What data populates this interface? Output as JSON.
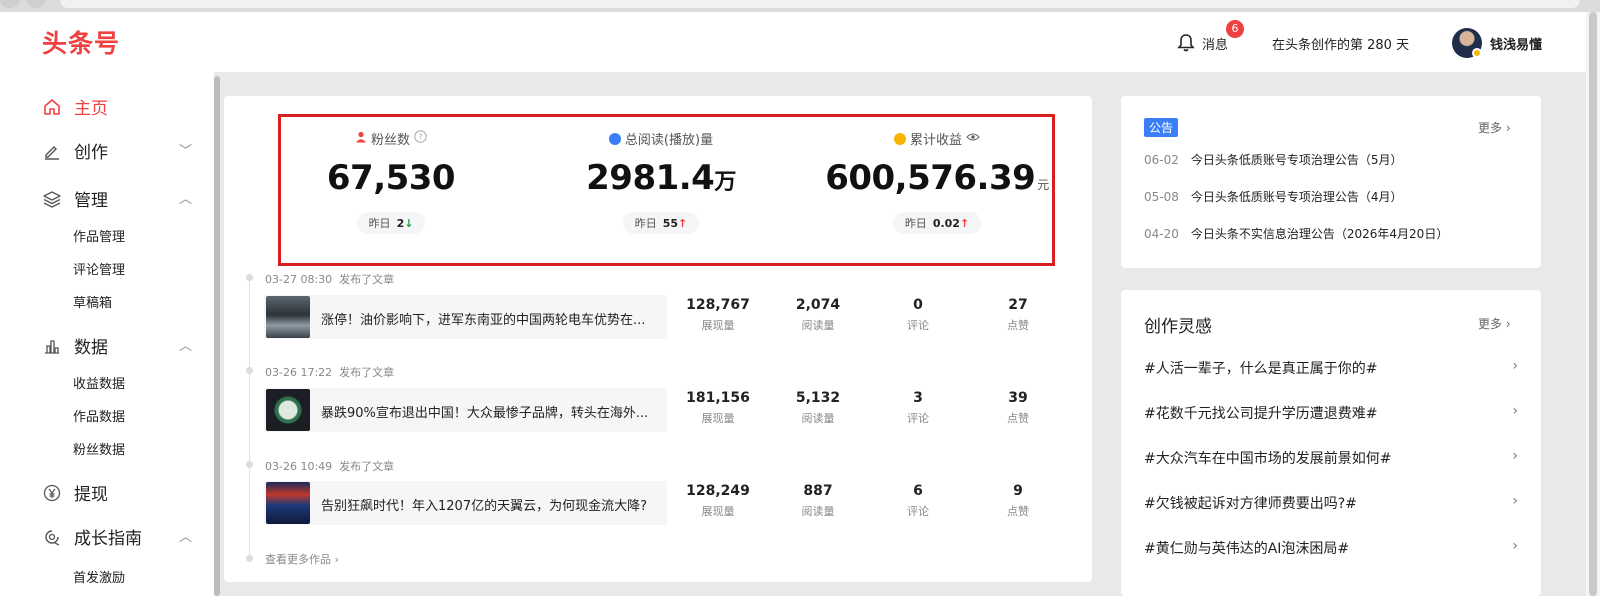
{
  "header": {
    "logo": "头条号",
    "messages_label": "消息",
    "messages_badge": "6",
    "days_text": "在头条创作的第 280 天",
    "username": "钱浅易懂"
  },
  "sidebar": {
    "items": [
      {
        "label": "主页",
        "icon": "home-icon",
        "active": true
      },
      {
        "label": "创作",
        "icon": "pen-icon",
        "chevron": "down"
      },
      {
        "label": "管理",
        "icon": "layers-icon",
        "chevron": "up"
      },
      {
        "label": "作品管理"
      },
      {
        "label": "评论管理"
      },
      {
        "label": "草稿箱"
      },
      {
        "label": "数据",
        "icon": "bar-chart-icon",
        "chevron": "up"
      },
      {
        "label": "收益数据"
      },
      {
        "label": "作品数据"
      },
      {
        "label": "粉丝数据"
      },
      {
        "label": "提现",
        "icon": "yen-icon"
      },
      {
        "label": "成长指南",
        "icon": "growth-icon",
        "chevron": "up"
      },
      {
        "label": "首发激励"
      }
    ]
  },
  "stats": {
    "fans": {
      "label": "粉丝数",
      "value": "67,530",
      "yesterday_label": "昨日",
      "yesterday_value": "2",
      "trend": "down"
    },
    "reads": {
      "label": "总阅读(播放)量",
      "value": "2981.4",
      "unit": "万",
      "yesterday_label": "昨日",
      "yesterday_value": "55",
      "trend": "up"
    },
    "income": {
      "label": "累计收益",
      "value": "600,576.39",
      "unit": "元",
      "yesterday_label": "昨日",
      "yesterday_value": "0.02",
      "trend": "up"
    }
  },
  "articles": [
    {
      "time": "03-27 08:30",
      "action": "发布了文章",
      "title": "涨停！油价影响下，进军东南亚的中国两轮电车优势在...",
      "impressions": "128,767",
      "reads": "2,074",
      "comments": "0",
      "likes": "27"
    },
    {
      "time": "03-26 17:22",
      "action": "发布了文章",
      "title": "暴跌90%宣布退出中国！大众最惨子品牌，转头在海外...",
      "impressions": "181,156",
      "reads": "5,132",
      "comments": "3",
      "likes": "39"
    },
    {
      "time": "03-26 10:49",
      "action": "发布了文章",
      "title": "告别狂飙时代！年入1207亿的天翼云，为何现金流大降?",
      "impressions": "128,249",
      "reads": "887",
      "comments": "6",
      "likes": "9"
    }
  ],
  "metric_labels": {
    "impressions": "展现量",
    "reads": "阅读量",
    "comments": "评论",
    "likes": "点赞"
  },
  "more_works": "查看更多作品 ›",
  "notice": {
    "tag": "公告",
    "more": "更多 ›",
    "items": [
      {
        "date": "06-02",
        "text": "今日头条低质账号专项治理公告（5月）"
      },
      {
        "date": "05-08",
        "text": "今日头条低质账号专项治理公告（4月）"
      },
      {
        "date": "04-20",
        "text": "今日头条不实信息治理公告（2026年4月20日）"
      }
    ]
  },
  "inspiration": {
    "title": "创作灵感",
    "more": "更多 ›",
    "items": [
      "#人活一辈子，什么是真正属于你的#",
      "#花数千元找公司提升学历遭退费难#",
      "#大众汽车在中国市场的发展前景如何#",
      "#欠钱被起诉对方律师费要出吗?#",
      "#黄仁勋与英伟达的AI泡沫困局#"
    ]
  },
  "colors": {
    "accent": "#f04142",
    "notice_tag": "#3a7ff6",
    "highlight_box": "#d81e1e",
    "down": "#1a9e3f"
  }
}
